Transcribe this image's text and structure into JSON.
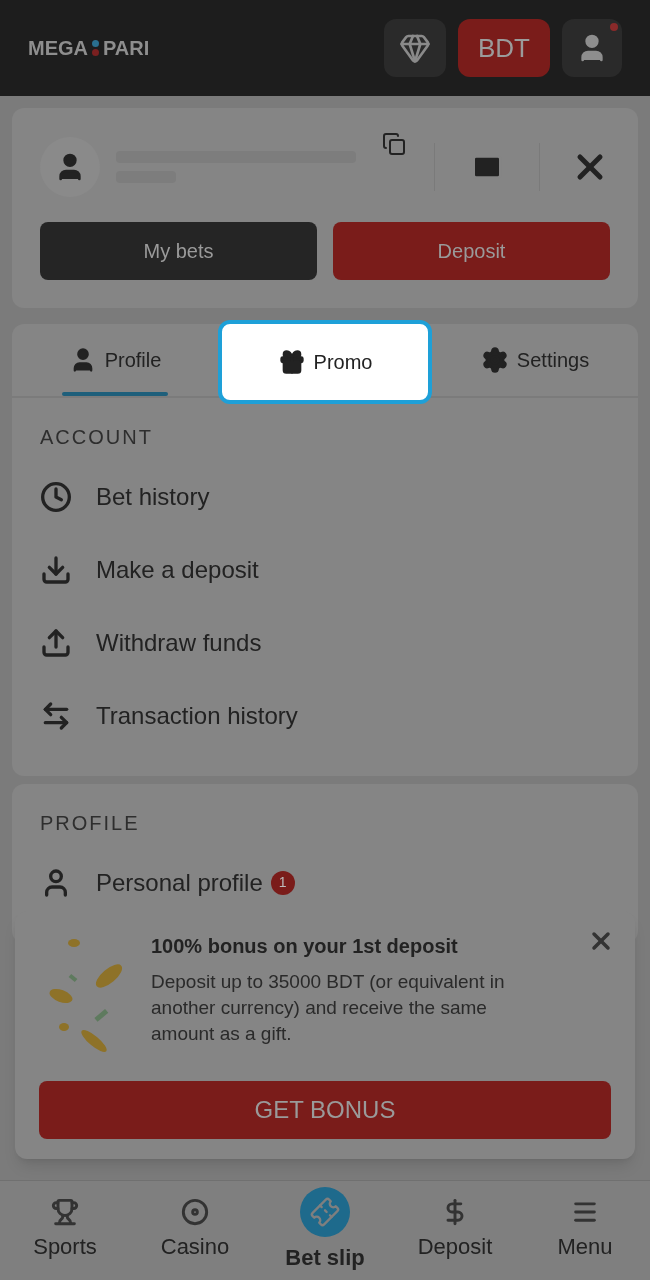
{
  "header": {
    "logo_left": "MEGA",
    "logo_right": "PARI",
    "currency": "BDT",
    "notification": true
  },
  "account_card": {
    "buttons": [
      {
        "label": "My bets",
        "kind": "dark"
      },
      {
        "label": "Deposit",
        "kind": "red"
      }
    ]
  },
  "tabs": [
    {
      "label": "Profile",
      "selected": true,
      "spotlight": false
    },
    {
      "label": "Promo",
      "selected": false,
      "spotlight": true
    },
    {
      "label": "Settings",
      "selected": false,
      "spotlight": false
    }
  ],
  "sections": [
    {
      "title": "ACCOUNT",
      "items": [
        {
          "label": "Bet history"
        },
        {
          "label": "Make a deposit"
        },
        {
          "label": "Withdraw funds"
        },
        {
          "label": "Transaction history"
        }
      ]
    },
    {
      "title": "PROFILE",
      "items": [
        {
          "label": "Personal profile",
          "badge": "1"
        }
      ]
    }
  ],
  "promo_popup": {
    "title": "100% bonus on your 1st deposit",
    "text": "Deposit up to 35000 BDT (or equivalent in another currency) and receive the same amount as a gift.",
    "button": "GET BONUS"
  },
  "bottom_nav": [
    {
      "label": "Sports",
      "selected": false
    },
    {
      "label": "Casino",
      "selected": false
    },
    {
      "label": "Bet slip",
      "selected": true
    },
    {
      "label": "Deposit",
      "selected": false
    },
    {
      "label": "Menu",
      "selected": false
    }
  ]
}
